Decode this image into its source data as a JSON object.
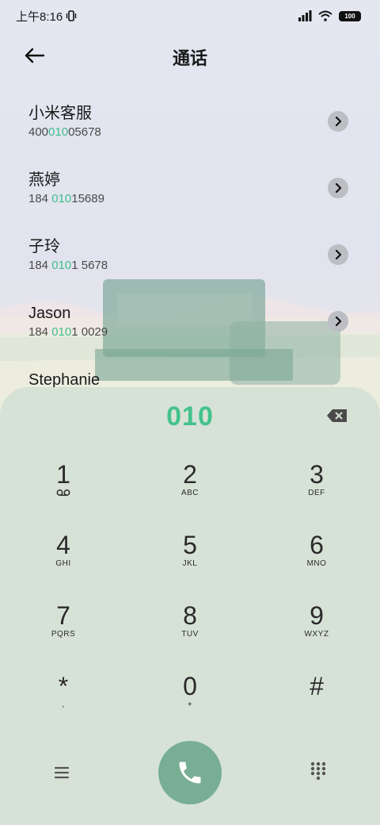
{
  "status_bar": {
    "time": "上午8:16",
    "battery": "100"
  },
  "header": {
    "title": "通话"
  },
  "contacts": [
    {
      "name": "小米客服",
      "number_pre": "400",
      "number_match": "010",
      "number_post": "05678"
    },
    {
      "name": "燕婷",
      "number_pre": "184 ",
      "number_match": "010",
      "number_post": "15689"
    },
    {
      "name": "子玲",
      "number_pre": "184 ",
      "number_match": "010",
      "number_post": "1 5678"
    },
    {
      "name": "Jason",
      "number_pre": "184 ",
      "number_match": "010",
      "number_post": "1 0029"
    },
    {
      "name": "Stephanie",
      "number_pre": "",
      "number_match": "",
      "number_post": ""
    }
  ],
  "dialpad": {
    "entered_number": "010",
    "keys": [
      [
        {
          "digit": "1",
          "sub": ""
        },
        {
          "digit": "2",
          "sub": "ABC"
        },
        {
          "digit": "3",
          "sub": "DEF"
        }
      ],
      [
        {
          "digit": "4",
          "sub": "GHI"
        },
        {
          "digit": "5",
          "sub": "JKL"
        },
        {
          "digit": "6",
          "sub": "MNO"
        }
      ],
      [
        {
          "digit": "7",
          "sub": "PQRS"
        },
        {
          "digit": "8",
          "sub": "TUV"
        },
        {
          "digit": "9",
          "sub": "WXYZ"
        }
      ],
      [
        {
          "digit": "*",
          "sub": ","
        },
        {
          "digit": "0",
          "sub": "+"
        },
        {
          "digit": "#",
          "sub": ""
        }
      ]
    ]
  },
  "icons": {
    "back": "back-arrow-icon",
    "chevron": "chevron-right-icon",
    "backspace": "backspace-icon",
    "voicemail": "voicemail-icon",
    "menu": "menu-icon",
    "call": "phone-icon",
    "keypad": "keypad-icon"
  },
  "colors": {
    "accent_green": "#43c28c",
    "call_button": "#78ae93",
    "dialpad_bg": "#d6e2d6"
  }
}
